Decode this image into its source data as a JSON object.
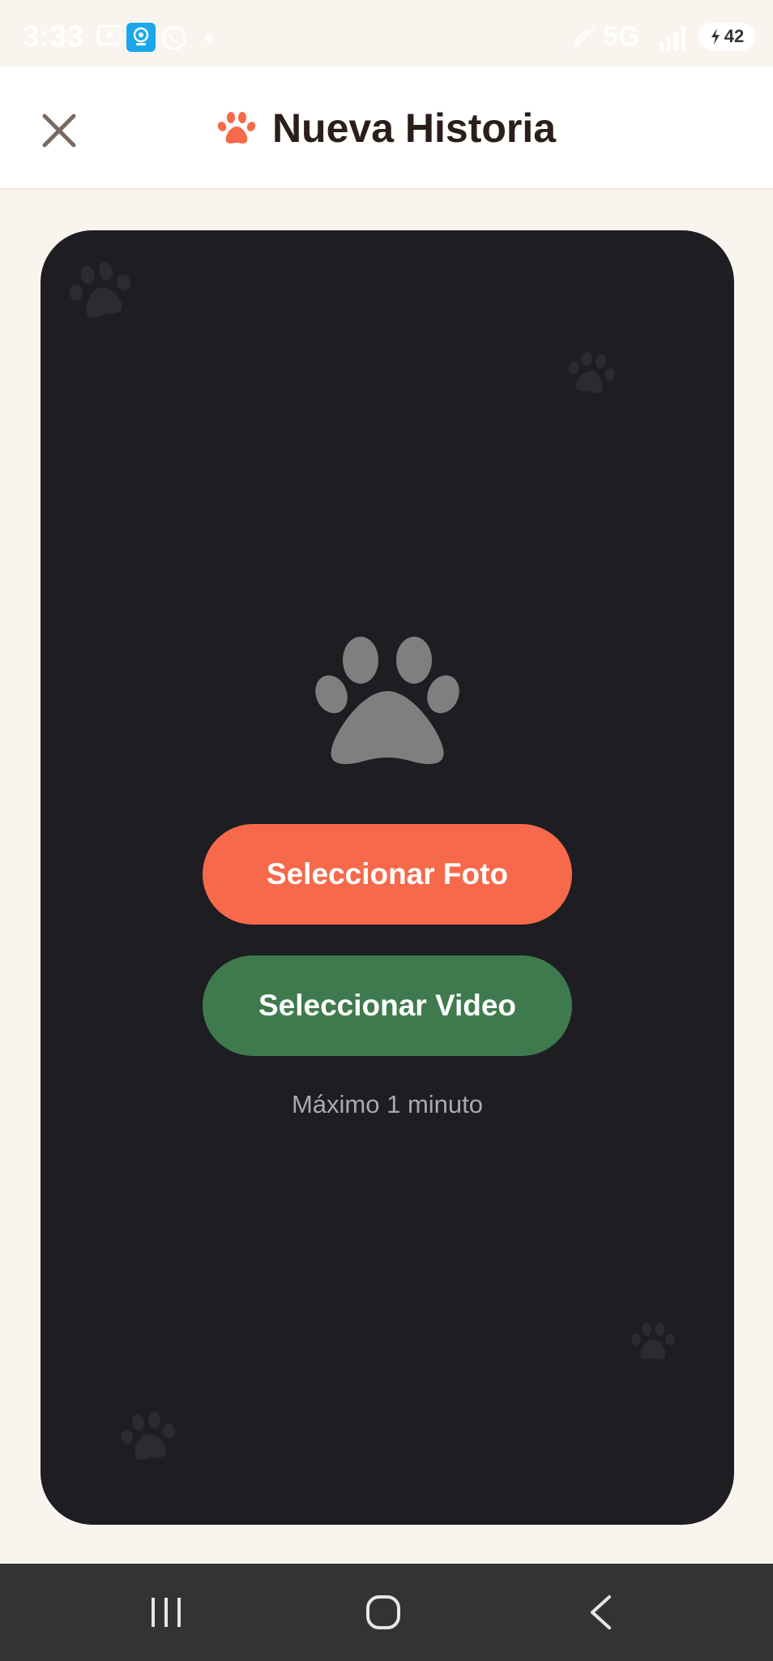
{
  "status_bar": {
    "time": "3:33",
    "network": "5G",
    "battery": "42",
    "icons": [
      "screen-record-icon",
      "webcam-app-icon",
      "whatsapp-icon",
      "dot-icon",
      "mute-icon",
      "signal-icon",
      "battery-icon"
    ]
  },
  "header": {
    "title": "Nueva Historia",
    "close_icon": "close-icon",
    "title_icon": "paw-icon",
    "accent_color": "#f6694a"
  },
  "card": {
    "background": "#1d1d22",
    "center_icon": "paw-icon",
    "photo_button_label": "Seleccionar Foto",
    "video_button_label": "Seleccionar Video",
    "hint": "Máximo 1 minuto",
    "colors": {
      "photo_button": "#f6694a",
      "video_button": "#3f7a4e"
    }
  },
  "nav_bar": {
    "items": [
      "recent-apps-icon",
      "home-icon",
      "back-icon"
    ]
  }
}
